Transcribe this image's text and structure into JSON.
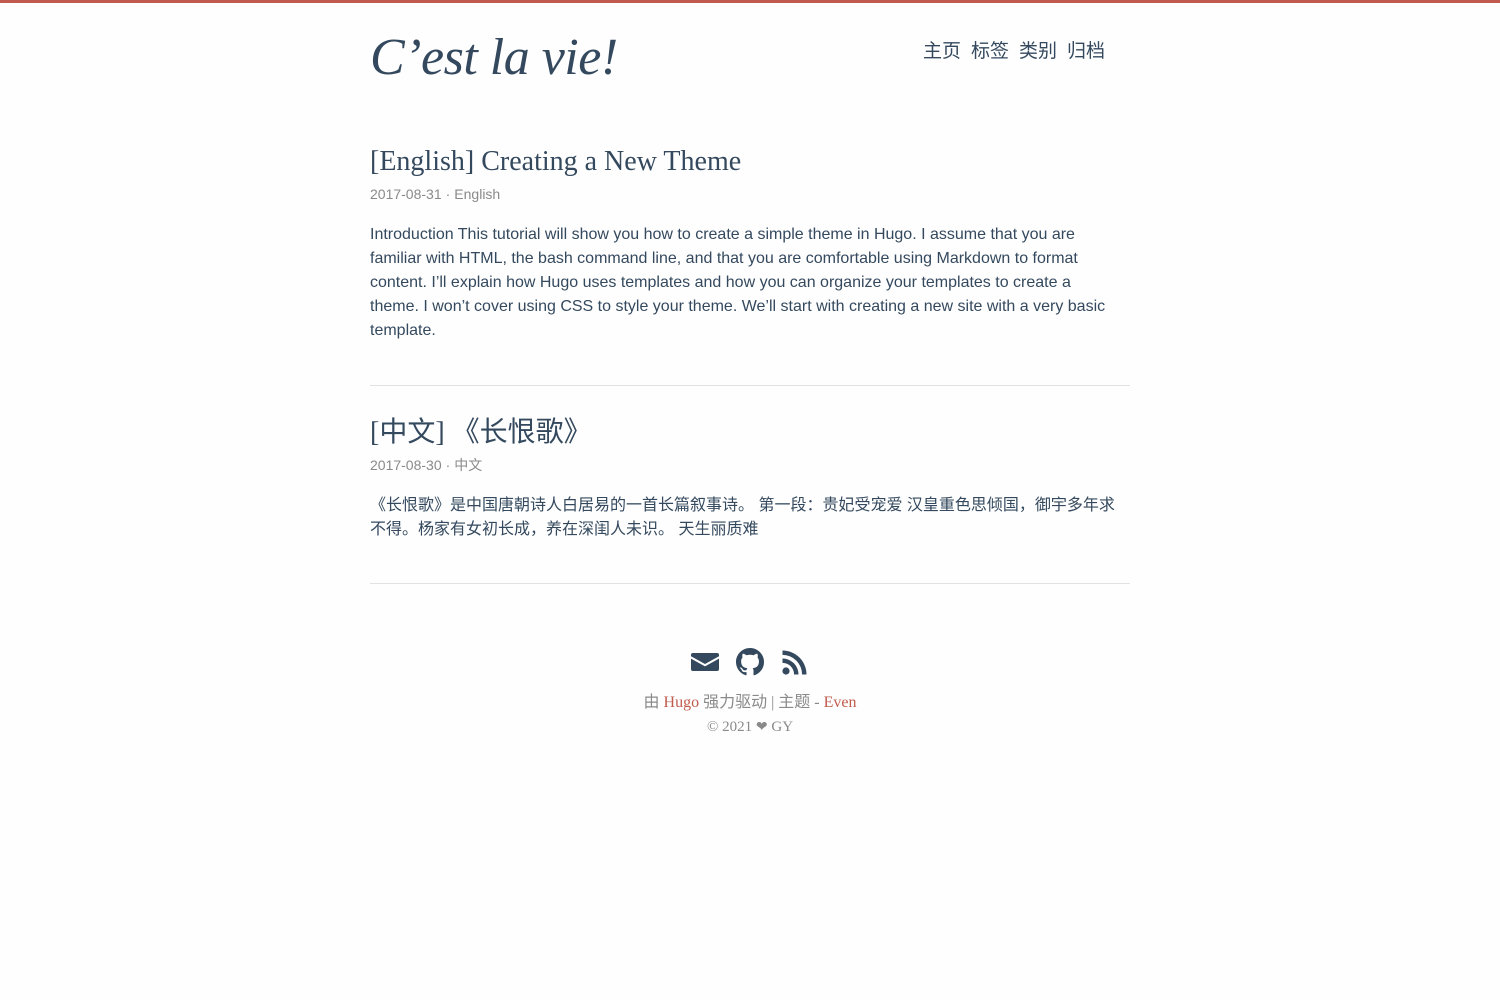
{
  "site": {
    "logo": "C’est la vie!"
  },
  "nav": {
    "items": [
      {
        "label": "主页"
      },
      {
        "label": "标签"
      },
      {
        "label": "类别"
      },
      {
        "label": "归档"
      }
    ]
  },
  "posts": [
    {
      "title": "[English] Creating a New Theme",
      "date": "2017-08-31",
      "separator": "·",
      "category": "English",
      "summary": "Introduction This tutorial will show you how to create a simple theme in Hugo. I assume that you are familiar with HTML, the bash command line, and that you are comfortable using Markdown to format content. I’ll explain how Hugo uses templates and how you can organize your templates to create a theme. I won’t cover using CSS to style your theme. We’ll start with creating a new site with a very basic template."
    },
    {
      "title": "[中文] 《长恨歌》",
      "date": "2017-08-30",
      "separator": "·",
      "category": "中文",
      "summary": "《长恨歌》是中国唐朝诗人白居易的一首长篇叙事诗。 第一段：贵妃受宠爱 汉皇重色思倾国，御宇多年求不得。杨家有女初长成，养在深闺人未识。 天生丽质难"
    }
  ],
  "footer": {
    "social": [
      {
        "icon": "email-icon"
      },
      {
        "icon": "github-icon"
      },
      {
        "icon": "rss-icon"
      }
    ],
    "powered_prefix": "由",
    "hugo_link": "Hugo",
    "powered_middle": "强力驱动 | 主题 -",
    "theme_link": "Even",
    "copyright_prefix": "© 2021",
    "heart": "❤",
    "author": "GY"
  },
  "colors": {
    "accent": "#c05b4d",
    "text": "#34495e",
    "muted": "#8a8a8a",
    "background": "#fefefe"
  }
}
